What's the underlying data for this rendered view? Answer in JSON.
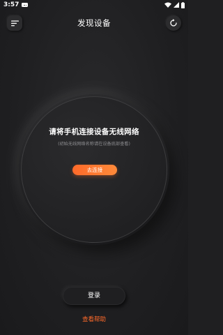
{
  "status_bar": {
    "time": "3:57"
  },
  "header": {
    "title": "发现设备",
    "menu_icon": "menu-icon",
    "refresh_icon": "refresh-icon"
  },
  "circle": {
    "title": "请将手机连接设备无线网络",
    "note": "(初始无线网络名称请在设备底部查看)",
    "connect_label": "去连接"
  },
  "footer": {
    "login_label": "登录",
    "help_label": "查看帮助"
  },
  "colors": {
    "accent": "#ff6a2a",
    "background": "#1f1f21"
  }
}
